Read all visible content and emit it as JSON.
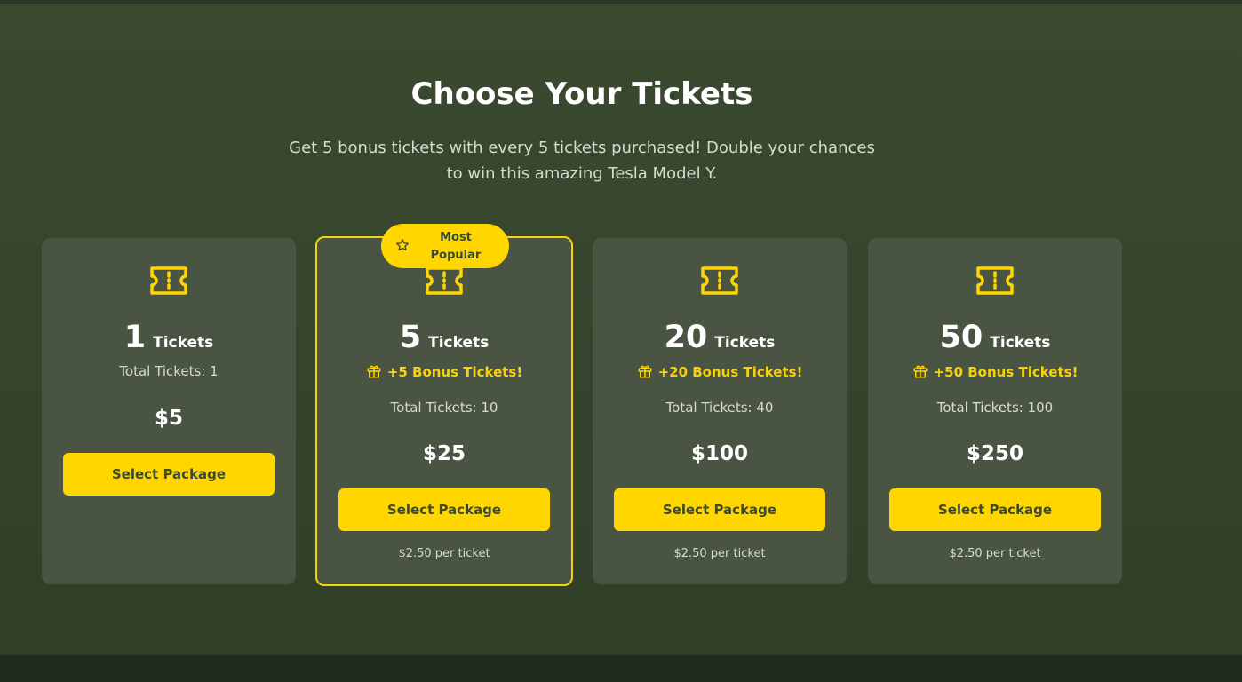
{
  "header": {
    "title": "Choose Your Tickets",
    "subtitle": "Get 5 bonus tickets with every 5 tickets purchased! Double your chances to win this amazing Tesla Model Y."
  },
  "packages": [
    {
      "quantity": "1",
      "unit_label": "Tickets",
      "bonus": "",
      "total": "Total Tickets: 1",
      "price": "$5",
      "button_label": "Select Package",
      "per_ticket": ""
    },
    {
      "quantity": "5",
      "unit_label": "Tickets",
      "bonus": "+5 Bonus Tickets!",
      "total": "Total Tickets: 10",
      "price": "$25",
      "button_label": "Select Package",
      "per_ticket": "$2.50 per ticket",
      "badge": "Most Popular"
    },
    {
      "quantity": "20",
      "unit_label": "Tickets",
      "bonus": "+20 Bonus Tickets!",
      "total": "Total Tickets: 40",
      "price": "$100",
      "button_label": "Select Package",
      "per_ticket": "$2.50 per ticket"
    },
    {
      "quantity": "50",
      "unit_label": "Tickets",
      "bonus": "+50 Bonus Tickets!",
      "total": "Total Tickets: 100",
      "price": "$250",
      "button_label": "Select Package",
      "per_ticket": "$2.50 per ticket"
    }
  ],
  "icons": {
    "ticket": "ticket-icon",
    "bonus": "gift-icon",
    "badge": "star-icon"
  },
  "colors": {
    "accent": "#ffd600",
    "background": "#3a4a2f",
    "card": "#4a5443",
    "button_text": "#3e4a2c"
  }
}
